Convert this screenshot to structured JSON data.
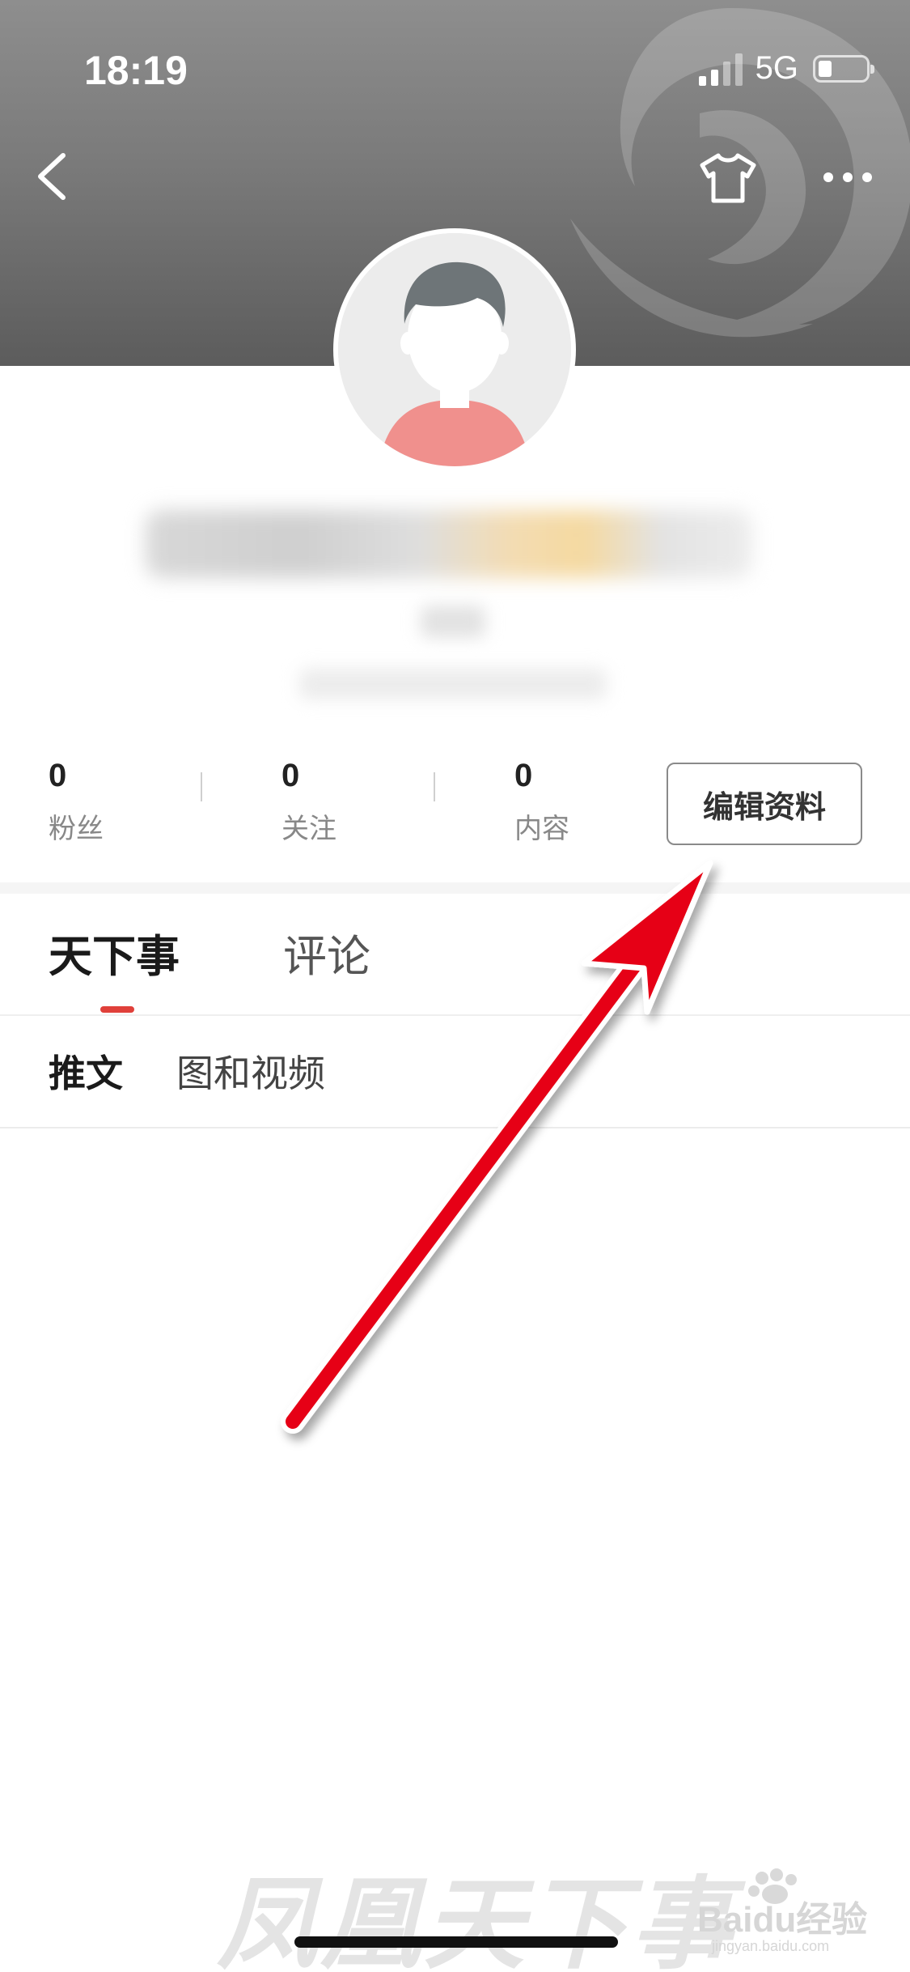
{
  "status_bar": {
    "time": "18:19",
    "network": "5G"
  },
  "profile": {
    "stats": [
      {
        "value": "0",
        "label": "粉丝"
      },
      {
        "value": "0",
        "label": "关注"
      },
      {
        "value": "0",
        "label": "内容"
      }
    ],
    "edit_button_label": "编辑资料"
  },
  "tabs": {
    "primary": [
      "天下事",
      "评论"
    ],
    "secondary": [
      "推文",
      "图和视频"
    ]
  },
  "watermark": {
    "app": "凤凰天下事",
    "baidu": "Baidu经验",
    "baidu_sub": "jingyan.baidu.com"
  },
  "colors": {
    "accent": "#e0403a",
    "annotation_arrow": "#e60012"
  }
}
